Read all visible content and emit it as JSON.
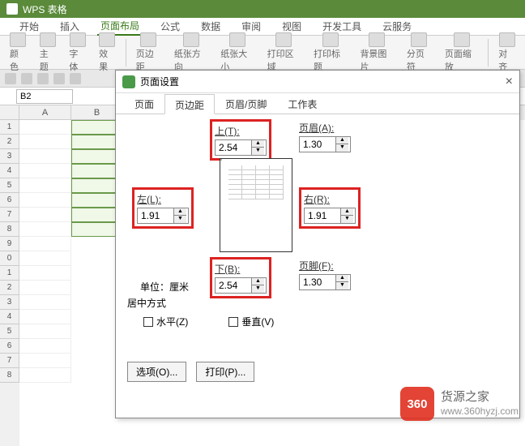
{
  "app": {
    "name": "WPS 表格"
  },
  "ribbon": {
    "tabs": [
      "开始",
      "插入",
      "页面布局",
      "公式",
      "数据",
      "审阅",
      "视图",
      "开发工具",
      "云服务"
    ],
    "active": 2,
    "groups": {
      "color": "颜色",
      "theme": "主题",
      "font": "字体",
      "effect": "效果",
      "margins": "页边距",
      "orientation": "纸张方向",
      "size": "纸张大小",
      "printArea": "打印区域",
      "printTitles": "打印标题",
      "bgImage": "背景图片",
      "breaks": "分页符",
      "scale": "页面缩放",
      "align": "对齐"
    }
  },
  "namebox": "B2",
  "columns": [
    "A",
    "B"
  ],
  "rows": [
    "1",
    "2",
    "3",
    "4",
    "5",
    "6",
    "7",
    "8",
    "9",
    "0",
    "1",
    "2",
    "3",
    "4",
    "5",
    "6",
    "7",
    "8"
  ],
  "dialog": {
    "title": "页面设置",
    "tabs": [
      "页面",
      "页边距",
      "页眉/页脚",
      "工作表"
    ],
    "activeTab": 1,
    "labels": {
      "top": "上(T):",
      "bottom": "下(B):",
      "left": "左(L):",
      "right": "右(R):",
      "header": "页眉(A):",
      "footer": "页脚(F):",
      "unitLabel": "单位：",
      "unitValue": "厘米",
      "centerTitle": "居中方式",
      "horiz": "水平(Z)",
      "vert": "垂直(V)",
      "options": "选项(O)...",
      "print": "打印(P)..."
    },
    "values": {
      "top": "2.54",
      "bottom": "2.54",
      "left": "1.91",
      "right": "1.91",
      "header": "1.30",
      "footer": "1.30"
    }
  },
  "watermark": {
    "badge": "360",
    "line1": "货源之家",
    "line2": "www.360hyzj.com"
  }
}
